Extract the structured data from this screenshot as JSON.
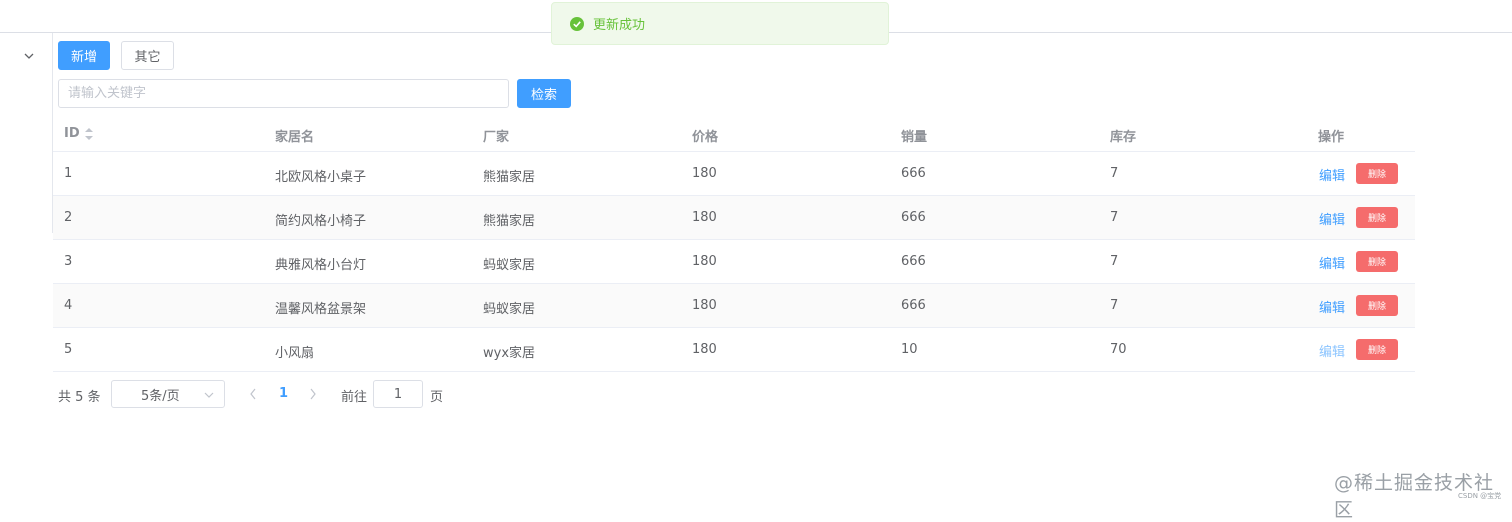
{
  "toast": {
    "message": "更新成功",
    "icon": "success-check-icon",
    "color": "#67c23a"
  },
  "toolbar": {
    "add_label": "新增",
    "other_label": "其它",
    "search_label": "检索",
    "search_placeholder": "请输入关键字",
    "search_value": ""
  },
  "table": {
    "headers": [
      "ID",
      "家居名",
      "厂家",
      "价格",
      "销量",
      "库存",
      "操作"
    ],
    "rows": [
      {
        "id": "1",
        "name": "北欧风格小桌子",
        "maker": "熊猫家居",
        "price": "180",
        "sales": "666",
        "stock": "7"
      },
      {
        "id": "2",
        "name": "简约风格小椅子",
        "maker": "熊猫家居",
        "price": "180",
        "sales": "666",
        "stock": "7"
      },
      {
        "id": "3",
        "name": "典雅风格小台灯",
        "maker": "蚂蚁家居",
        "price": "180",
        "sales": "666",
        "stock": "7"
      },
      {
        "id": "4",
        "name": "温馨风格盆景架",
        "maker": "蚂蚁家居",
        "price": "180",
        "sales": "666",
        "stock": "7"
      },
      {
        "id": "5",
        "name": "小风扇",
        "maker": "wyx家居",
        "price": "180",
        "sales": "10",
        "stock": "70"
      }
    ],
    "edit_label": "编辑",
    "delete_label": "删除"
  },
  "pagination": {
    "total": "共 5 条",
    "page_size": "5条/页",
    "current_page": "1",
    "goto_label": "前往",
    "goto_value": "1",
    "page_suffix": "页"
  },
  "watermark": {
    "text": "@稀土掘金技术社区",
    "sub": "CSDN @宝党"
  },
  "colors": {
    "primary": "#409eff",
    "danger": "#f56c6c",
    "success": "#67c23a"
  }
}
